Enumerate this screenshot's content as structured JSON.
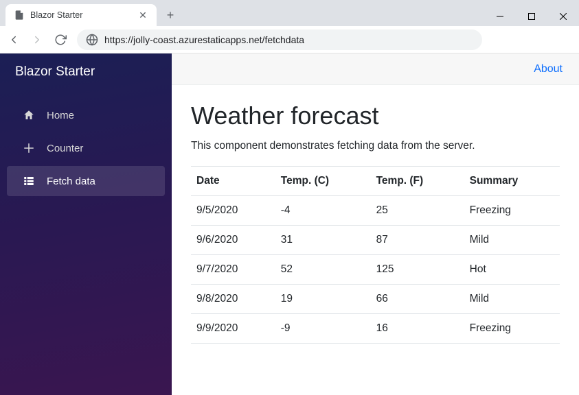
{
  "browser": {
    "tab_title": "Blazor Starter",
    "url": "https://jolly-coast.azurestaticapps.net/fetchdata"
  },
  "sidebar": {
    "brand": "Blazor Starter",
    "items": [
      {
        "label": "Home"
      },
      {
        "label": "Counter"
      },
      {
        "label": "Fetch data"
      }
    ],
    "active_index": 2
  },
  "topbar": {
    "about": "About"
  },
  "page": {
    "title": "Weather forecast",
    "description": "This component demonstrates fetching data from the server.",
    "columns": [
      "Date",
      "Temp. (C)",
      "Temp. (F)",
      "Summary"
    ],
    "rows": [
      {
        "date": "9/5/2020",
        "tc": "-4",
        "tf": "25",
        "summary": "Freezing"
      },
      {
        "date": "9/6/2020",
        "tc": "31",
        "tf": "87",
        "summary": "Mild"
      },
      {
        "date": "9/7/2020",
        "tc": "52",
        "tf": "125",
        "summary": "Hot"
      },
      {
        "date": "9/8/2020",
        "tc": "19",
        "tf": "66",
        "summary": "Mild"
      },
      {
        "date": "9/9/2020",
        "tc": "-9",
        "tf": "16",
        "summary": "Freezing"
      }
    ]
  }
}
